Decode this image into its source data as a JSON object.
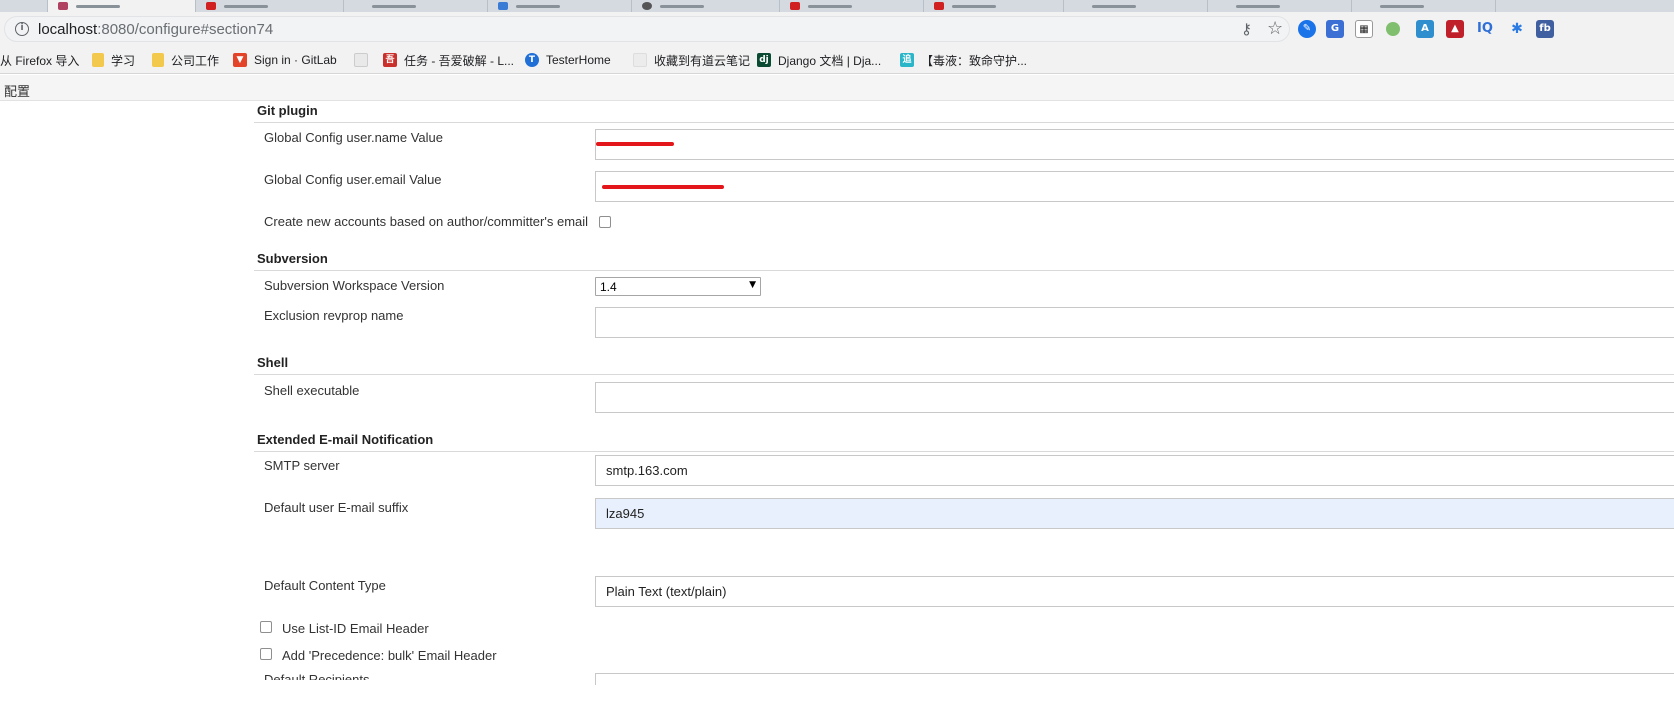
{
  "browser": {
    "url_host": "localhost",
    "url_path": ":8080/configure#section74",
    "bookmarks": [
      {
        "label": "从 Firefox 导入",
        "icon": "firefox-import-icon",
        "color": ""
      },
      {
        "label": "学习",
        "icon": "folder-icon",
        "color": "#f2c94c"
      },
      {
        "label": "公司工作",
        "icon": "folder-icon",
        "color": "#f2c94c"
      },
      {
        "label": "Sign in · GitLab",
        "icon": "gitlab-icon",
        "color": "#e24329"
      },
      {
        "label": "任务 - 吾爱破解 - L...",
        "icon": "52pojie-icon",
        "color": "#c9302c"
      },
      {
        "label": "TesterHome",
        "icon": "testerhome-icon",
        "color": "#1f6fd6"
      },
      {
        "label": "收藏到有道云笔记",
        "icon": "youdao-icon",
        "color": "#e0e0e0"
      },
      {
        "label": "Django 文档 | Dja...",
        "icon": "django-icon",
        "color": "#0c4b33"
      },
      {
        "label": "【毒液：致命守护...",
        "icon": "movie-icon",
        "color": "#2bb5c9"
      }
    ]
  },
  "breadcrumb": {
    "label": "配置"
  },
  "sections": {
    "git": {
      "title": "Git plugin",
      "username_label": "Global Config user.name Value",
      "email_label": "Global Config user.email Value",
      "create_accounts_label": "Create new accounts based on author/committer's email"
    },
    "svn": {
      "title": "Subversion",
      "workspace_label": "Subversion Workspace Version",
      "workspace_value": "1.4",
      "revprop_label": "Exclusion revprop name"
    },
    "shell": {
      "title": "Shell",
      "executable_label": "Shell executable"
    },
    "email": {
      "title": "Extended E-mail Notification",
      "smtp_label": "SMTP server",
      "smtp_value": "smtp.163.com",
      "suffix_label": "Default user E-mail suffix",
      "suffix_value": "lza945",
      "content_type_label": "Default Content Type",
      "content_type_value": "Plain Text (text/plain)",
      "list_id_label": "Use List-ID Email Header",
      "precedence_label": "Add 'Precedence: bulk' Email Header",
      "recipients_label": "Default Recipients"
    }
  }
}
